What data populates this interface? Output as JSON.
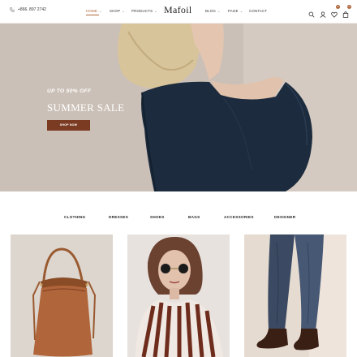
{
  "header": {
    "phone": "+866. 897 2742",
    "logo": "Mafoil",
    "nav": [
      {
        "label": "HOME",
        "caret": "⌄"
      },
      {
        "label": "SHOP",
        "caret": "⌄"
      },
      {
        "label": "PRODUCTS",
        "caret": "⌄"
      },
      {
        "label": "BLOG",
        "caret": "⌄"
      },
      {
        "label": "PAGE",
        "caret": "⌄"
      },
      {
        "label": "CONTACT"
      }
    ],
    "active_nav": "HOME",
    "icons": [
      "search-icon",
      "user-icon",
      "heart-icon",
      "bag-icon"
    ],
    "wishlist_count": "0",
    "cart_count": "0"
  },
  "hero": {
    "subtitle": "UP TO 50% OFF",
    "title": "SUMMER SALE",
    "button": "SHOP NOW"
  },
  "categories": [
    "CLOTHING",
    "DRESSES",
    "SHOES",
    "BAGS",
    "ACCESSORIES",
    "DESIGNER"
  ],
  "products": [
    {
      "image": "leather-bucket-bag"
    },
    {
      "image": "woman-striped-shirt-sunglasses"
    },
    {
      "image": "jeans-and-boots"
    }
  ],
  "colors": {
    "accent": "#b0653a",
    "button": "#7a3b22",
    "hero_bg": "#cfc4bb"
  }
}
